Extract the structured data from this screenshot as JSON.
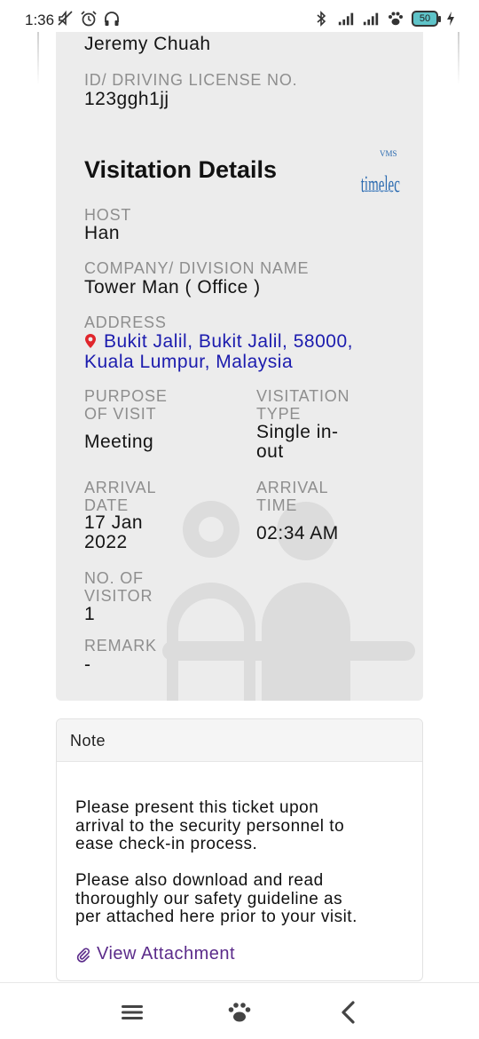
{
  "status_bar": {
    "time": "1:36",
    "battery": "50"
  },
  "visitor": {
    "name": "Jeremy Chuah",
    "id_label": "ID/ DRIVING LICENSE NO.",
    "id_value": "123ggh1jj"
  },
  "visitation": {
    "title": "Visitation Details",
    "host_label": "HOST",
    "host_value": "Han",
    "company_label": "COMPANY/ DIVISION NAME",
    "company_value": "Tower Man ( Office )",
    "address_label": "ADDRESS",
    "address_value": "Bukit Jalil, Bukit Jalil, 58000, Kuala Lumpur, Malaysia",
    "purpose_label_1": "PURPOSE",
    "purpose_label_2": "OF VISIT",
    "purpose_value": "Meeting",
    "type_label_1": "VISITATION",
    "type_label_2": "TYPE",
    "type_value_1": "Single in-",
    "type_value_2": "out",
    "arrival_date_label_1": "ARRIVAL",
    "arrival_date_label_2": "DATE",
    "arrival_date_value_1": "17 Jan",
    "arrival_date_value_2": "2022",
    "arrival_time_label_1": "ARRIVAL",
    "arrival_time_label_2": "TIME",
    "arrival_time_value": "02:34 AM",
    "visitors_label_1": "NO. OF",
    "visitors_label_2": "VISITOR",
    "visitors_value": "1",
    "remark_label": "REMARK",
    "remark_value": "-"
  },
  "logo": {
    "brand": "timelec",
    "sub": "VMS"
  },
  "note": {
    "header": "Note",
    "p1_l1": "Please present this ticket upon",
    "p1_l2": "arrival to the security personnel to",
    "p1_l3": "ease check-in process.",
    "p2_l1": "Please also download and read",
    "p2_l2": "thoroughly our safety guideline as",
    "p2_l3": "per attached here prior to your visit.",
    "attachment_link": "View Attachment"
  },
  "colors": {
    "card_bg": "#ececec",
    "link_blue": "#1c1cae",
    "pin_red": "#e0262c",
    "attachment_purple": "#5b2b8a",
    "logo_blue": "#2a6ab0"
  },
  "icons": [
    "mute-icon",
    "alarm-icon",
    "headset-icon",
    "bluetooth-icon",
    "signal-icon",
    "paw-icon",
    "battery-icon",
    "charging-icon",
    "location-pin-icon",
    "paperclip-icon",
    "menu-icon",
    "home-paw-icon",
    "back-icon"
  ]
}
